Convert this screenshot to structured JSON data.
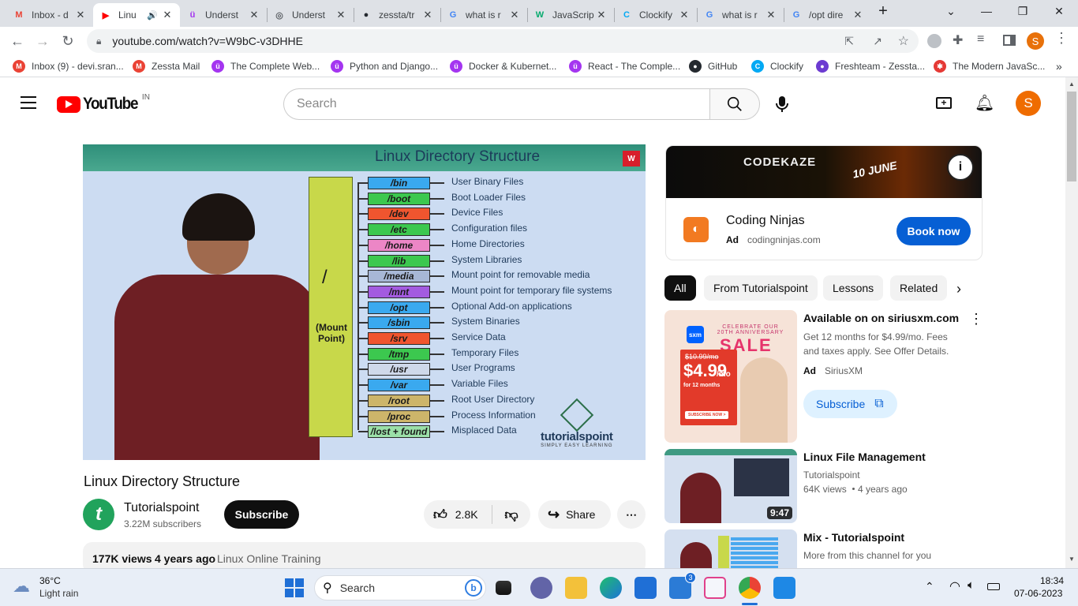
{
  "browser": {
    "tabs": [
      {
        "title": "Inbox - d",
        "icon": "gmail-icon",
        "color": "#ea4335",
        "letter": "M"
      },
      {
        "title": "Linu",
        "icon": "youtube-icon",
        "color": "#ff0000",
        "letter": "▶",
        "active": true,
        "audio": "🔊"
      },
      {
        "title": "Underst",
        "icon": "udemy-icon",
        "color": "#a435f0",
        "letter": "ü"
      },
      {
        "title": "Underst",
        "icon": "globe-icon",
        "color": "#5f6368",
        "letter": "◎"
      },
      {
        "title": "zessta/tr",
        "icon": "github-icon",
        "color": "#24292f",
        "letter": "●"
      },
      {
        "title": "what is r",
        "icon": "google-icon",
        "color": "#4285f4",
        "letter": "G"
      },
      {
        "title": "JavaScrip",
        "icon": "w3schools-icon",
        "color": "#04aa6d",
        "letter": "W"
      },
      {
        "title": "Clockify",
        "icon": "clockify-icon",
        "color": "#03a9f4",
        "letter": "C"
      },
      {
        "title": "what is r",
        "icon": "google-icon",
        "color": "#4285f4",
        "letter": "G"
      },
      {
        "title": "/opt dire",
        "icon": "google-icon",
        "color": "#4285f4",
        "letter": "G"
      }
    ],
    "new_tab": "+",
    "url": "youtube.com/watch?v=W9bC-v3DHHE",
    "bookmarks": [
      {
        "label": "Inbox (9) - devi.sran...",
        "color": "#ea4335",
        "letter": "M"
      },
      {
        "label": "Zessta Mail",
        "color": "#ea4335",
        "letter": "M"
      },
      {
        "label": "The Complete Web...",
        "color": "#a435f0",
        "letter": "ü"
      },
      {
        "label": "Python and Django...",
        "color": "#a435f0",
        "letter": "ü"
      },
      {
        "label": "Docker & Kubernet...",
        "color": "#a435f0",
        "letter": "ü"
      },
      {
        "label": "React - The Comple...",
        "color": "#a435f0",
        "letter": "ü"
      },
      {
        "label": "GitHub",
        "color": "#24292f",
        "letter": "●"
      },
      {
        "label": "Clockify",
        "color": "#03a9f4",
        "letter": "C"
      },
      {
        "label": "Freshteam - Zessta...",
        "color": "#6c3bd1",
        "letter": "●"
      },
      {
        "label": "The Modern JavaSc...",
        "color": "#e53935",
        "letter": "✱"
      }
    ],
    "more": "»",
    "profile_letter": "S"
  },
  "youtube": {
    "logo_text": "YouTube",
    "country": "IN",
    "search_placeholder": "Search",
    "avatar_letter": "S"
  },
  "video": {
    "slide_title": "Linux Directory Structure",
    "root_label": "/",
    "mount_label": "(Mount Point)",
    "dirs": [
      {
        "name": "/bin",
        "desc": "User Binary Files",
        "color": "#3aa9ef"
      },
      {
        "name": "/boot",
        "desc": "Boot Loader Files",
        "color": "#3cc84f"
      },
      {
        "name": "/dev",
        "desc": "Device Files",
        "color": "#f0552f"
      },
      {
        "name": "/etc",
        "desc": "Configuration files",
        "color": "#3cc84f"
      },
      {
        "name": "/home",
        "desc": "Home Directories",
        "color": "#ec86c6"
      },
      {
        "name": "/lib",
        "desc": "System Libraries",
        "color": "#3cc84f"
      },
      {
        "name": "/media",
        "desc": "Mount point for removable media",
        "color": "#a7b7d6"
      },
      {
        "name": "/mnt",
        "desc": "Mount point for temporary file systems",
        "color": "#a35be0"
      },
      {
        "name": "/opt",
        "desc": "Optional Add-on applications",
        "color": "#3aa9ef"
      },
      {
        "name": "/sbin",
        "desc": "System Binaries",
        "color": "#3aa9ef"
      },
      {
        "name": "/srv",
        "desc": "Service Data",
        "color": "#f0552f"
      },
      {
        "name": "/tmp",
        "desc": "Temporary Files",
        "color": "#3cc84f"
      },
      {
        "name": "/usr",
        "desc": "User Programs",
        "color": "#cfd9ea"
      },
      {
        "name": "/var",
        "desc": "Variable Files",
        "color": "#3aa9ef"
      },
      {
        "name": "/root",
        "desc": "Root User Directory",
        "color": "#cdb56a"
      },
      {
        "name": "/proc",
        "desc": "Process Information",
        "color": "#cdb56a"
      },
      {
        "name": "/lost + found",
        "desc": "Misplaced Data",
        "color": "#9be0a8"
      }
    ],
    "watermark": "tutorialspoint",
    "watermark_sub": "SIMPLY EASY LEARNING",
    "title": "Linux Directory Structure",
    "channel": "Tutorialspoint",
    "subscribers": "3.22M subscribers",
    "subscribe": "Subscribe",
    "likes": "2.8K",
    "share": "Share",
    "more": "⋯",
    "views": "177K views",
    "age": "4 years ago",
    "tag": "Linux Online Training"
  },
  "sidebar": {
    "ad_banner": {
      "brand": "CODEKAZE",
      "date": "10 JUNE"
    },
    "ad": {
      "name": "Coding Ninjas",
      "badge": "Ad",
      "domain": "codingninjas.com",
      "cta": "Book now"
    },
    "chips": [
      "All",
      "From Tutorialspoint",
      "Lessons",
      "Related"
    ],
    "promo": {
      "title": "Available on on siriusxm.com",
      "desc": "Get 12 months for $4.99/mo. Fees and taxes apply. See Offer Details.",
      "badge": "Ad",
      "advertiser": "SiriusXM",
      "cta": "Subscribe",
      "thumb_logo": "sxm",
      "thumb_top": "CELEBRATE OUR 20TH ANNIVERSARY",
      "thumb_sale": "SALE",
      "thumb_old": "$10.99/mo",
      "thumb_price": "$4.99",
      "thumb_per": "/mo",
      "thumb_term": "for 12 months",
      "thumb_button": "SUBSCRIBE NOW >"
    },
    "videos": [
      {
        "title": "Linux File Management",
        "channel": "Tutorialspoint",
        "views": "64K views",
        "age": "4 years ago",
        "duration": "9:47"
      },
      {
        "title": "Mix - Tutorialspoint",
        "channel": "More from this channel for you"
      }
    ]
  },
  "taskbar": {
    "weather_temp": "36°C",
    "weather_desc": "Light rain",
    "search": "Search",
    "mail_badge": "3",
    "time": "18:34",
    "date": "07-06-2023"
  }
}
